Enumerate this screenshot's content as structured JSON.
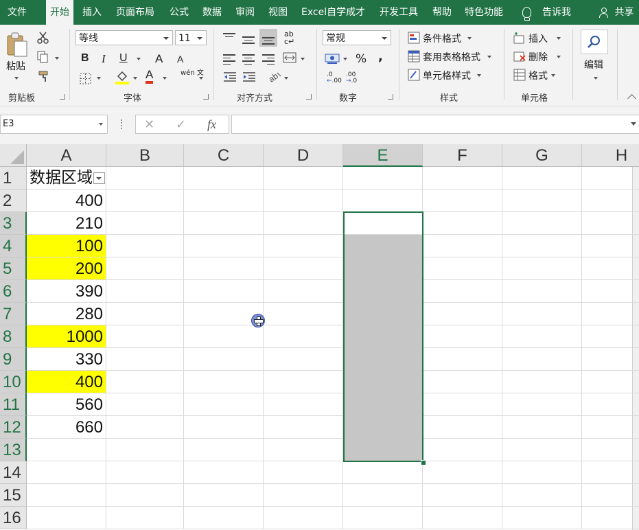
{
  "menu": {
    "tabs": [
      "文件",
      "开始",
      "插入",
      "页面布局",
      "公式",
      "数据",
      "审阅",
      "视图",
      "Excel自学成才",
      "开发工具",
      "帮助",
      "特色功能"
    ],
    "active_tab": "开始",
    "tell_me": "告诉我",
    "share": "共享"
  },
  "ribbon": {
    "clipboard": {
      "paste": "粘贴",
      "group": "剪贴板"
    },
    "font": {
      "family": "等线",
      "size": "11",
      "bold": "B",
      "italic": "I",
      "underline": "U",
      "grow": "A",
      "shrink": "A",
      "font_color": "A",
      "phonetic": "wén 文",
      "group": "字体"
    },
    "alignment": {
      "group": "对齐方式"
    },
    "number": {
      "format": "常规",
      "percent": "%",
      "comma": ",",
      "inc_decimal": ".00",
      "dec_decimal": ".0",
      "group": "数字"
    },
    "styles": {
      "conditional": "条件格式",
      "table": "套用表格格式",
      "cell_styles": "单元格样式",
      "group": "样式"
    },
    "cells": {
      "insert": "插入",
      "delete": "删除",
      "format": "格式",
      "group": "单元格"
    },
    "editing": {
      "label": "编辑"
    }
  },
  "formula_bar": {
    "name_box": "E3",
    "cancel": "✕",
    "enter": "✓",
    "fx": "fx",
    "value": ""
  },
  "sheet": {
    "columns": [
      "A",
      "B",
      "C",
      "D",
      "E",
      "F",
      "G",
      "H"
    ],
    "selected_column": "E",
    "rows": [
      "1",
      "2",
      "3",
      "4",
      "5",
      "6",
      "7",
      "8",
      "9",
      "10",
      "11",
      "12",
      "13",
      "14",
      "15",
      "16"
    ],
    "selected_rows": [
      "3",
      "4",
      "5",
      "6",
      "7",
      "8",
      "9",
      "10",
      "11",
      "12",
      "13"
    ],
    "columnA": [
      "数据区域",
      "400",
      "210",
      "100",
      "200",
      "390",
      "280",
      "1000",
      "330",
      "400",
      "560",
      "660",
      "",
      "",
      "",
      ""
    ],
    "highlighted_rows": [
      4,
      5,
      8,
      10
    ],
    "highlight_color": "#ffff00",
    "active_cell": "E3",
    "selection": "E3:E13"
  },
  "colors": {
    "brand": "#217346",
    "selection_fill": "#c6c6c6"
  }
}
